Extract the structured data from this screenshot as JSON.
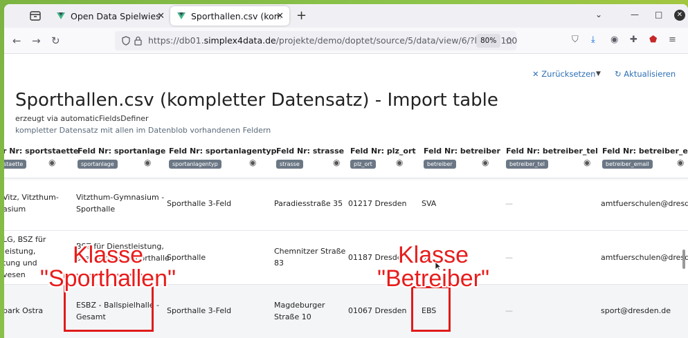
{
  "browser": {
    "tabs": [
      {
        "title": "Open Data Spielwiese - Q",
        "active": false
      },
      {
        "title": "Sporthallen.csv (komplett",
        "active": true
      }
    ],
    "url_prefix": "https://db01.",
    "url_domain": "simplex4data.de",
    "url_path": "/projekte/demo/doptet/source/5/data/view/6/?limit=100",
    "zoom": "80%"
  },
  "page": {
    "reset_label": "Zurücksetzen",
    "refresh_label": "Aktualisieren",
    "title": "Sporthallen.csv (kompletter Datensatz) - Import table",
    "subtitle": "erzeugt via automaticFieldsDefiner",
    "description": "kompletter Datensatz mit allen im Datenblob vorhandenen Feldern"
  },
  "table": {
    "columns": [
      {
        "label": "r Nr: sportstaette",
        "pill": "staette"
      },
      {
        "label": "Feld Nr: sportanlage",
        "pill": "sportanlage"
      },
      {
        "label": "Feld Nr: sportanlagentyp",
        "pill": "sportanlagentyp"
      },
      {
        "label": "Feld Nr: strasse",
        "pill": "strasse"
      },
      {
        "label": "Feld Nr: plz_ort",
        "pill": "plz_ort"
      },
      {
        "label": "Feld Nr: betreiber",
        "pill": "betreiber"
      },
      {
        "label": "Feld Nr: betreiber_tel",
        "pill": "betreiber_tel"
      },
      {
        "label": "Feld Nr: betreiber_email",
        "pill": "betreiber_email"
      }
    ],
    "rows": [
      {
        "sportstaette": [
          "Vitz, Vitzthum-",
          "asium"
        ],
        "sportanlage": [
          "Vitzthum-Gymnasium -",
          "Sporthalle"
        ],
        "sportanlagentyp": "Sporthalle 3-Feld",
        "strasse": [
          "Paradiesstraße 35"
        ],
        "plz_ort": "01217 Dresden",
        "betreiber": "SVA",
        "betreiber_tel": "—",
        "betreiber_email": "amtfuerschulen@dresde"
      },
      {
        "sportstaette": [
          "LG, BSZ für",
          "leistung,",
          "tung und",
          "vesen"
        ],
        "sportanlage": [
          "BSZ für Dienstleistung,",
          "Sozialwesen - Sporthalle"
        ],
        "sportanlagentyp": "Sporthalle",
        "strasse": [
          "Chemnitzer Straße",
          "83"
        ],
        "plz_ort": "01187 Dresden",
        "betreiber": "SBS",
        "betreiber_tel": "—",
        "betreiber_email": "amtfuerschulen@dresde"
      },
      {
        "sportstaette": [
          "park Ostra"
        ],
        "sportanlage": [
          "ESBZ - Ballspielhalle -",
          "Gesamt"
        ],
        "sportanlagentyp": "Sporthalle 3-Feld",
        "strasse": [
          "Magdeburger",
          "Straße 10"
        ],
        "plz_ort": "01067 Dresden",
        "betreiber": "EBS",
        "betreiber_tel": "—",
        "betreiber_email": "sport@dresden.de"
      }
    ]
  },
  "annotations": {
    "sporthallen": [
      "Klasse",
      "\"Sporthallen\""
    ],
    "betreiber": [
      "Klasse",
      "\"Betreiber\""
    ]
  },
  "colors": {
    "annotation_red": "#e01b1b",
    "link_blue": "#2c6fb3",
    "pill_gray": "#6b7785"
  }
}
